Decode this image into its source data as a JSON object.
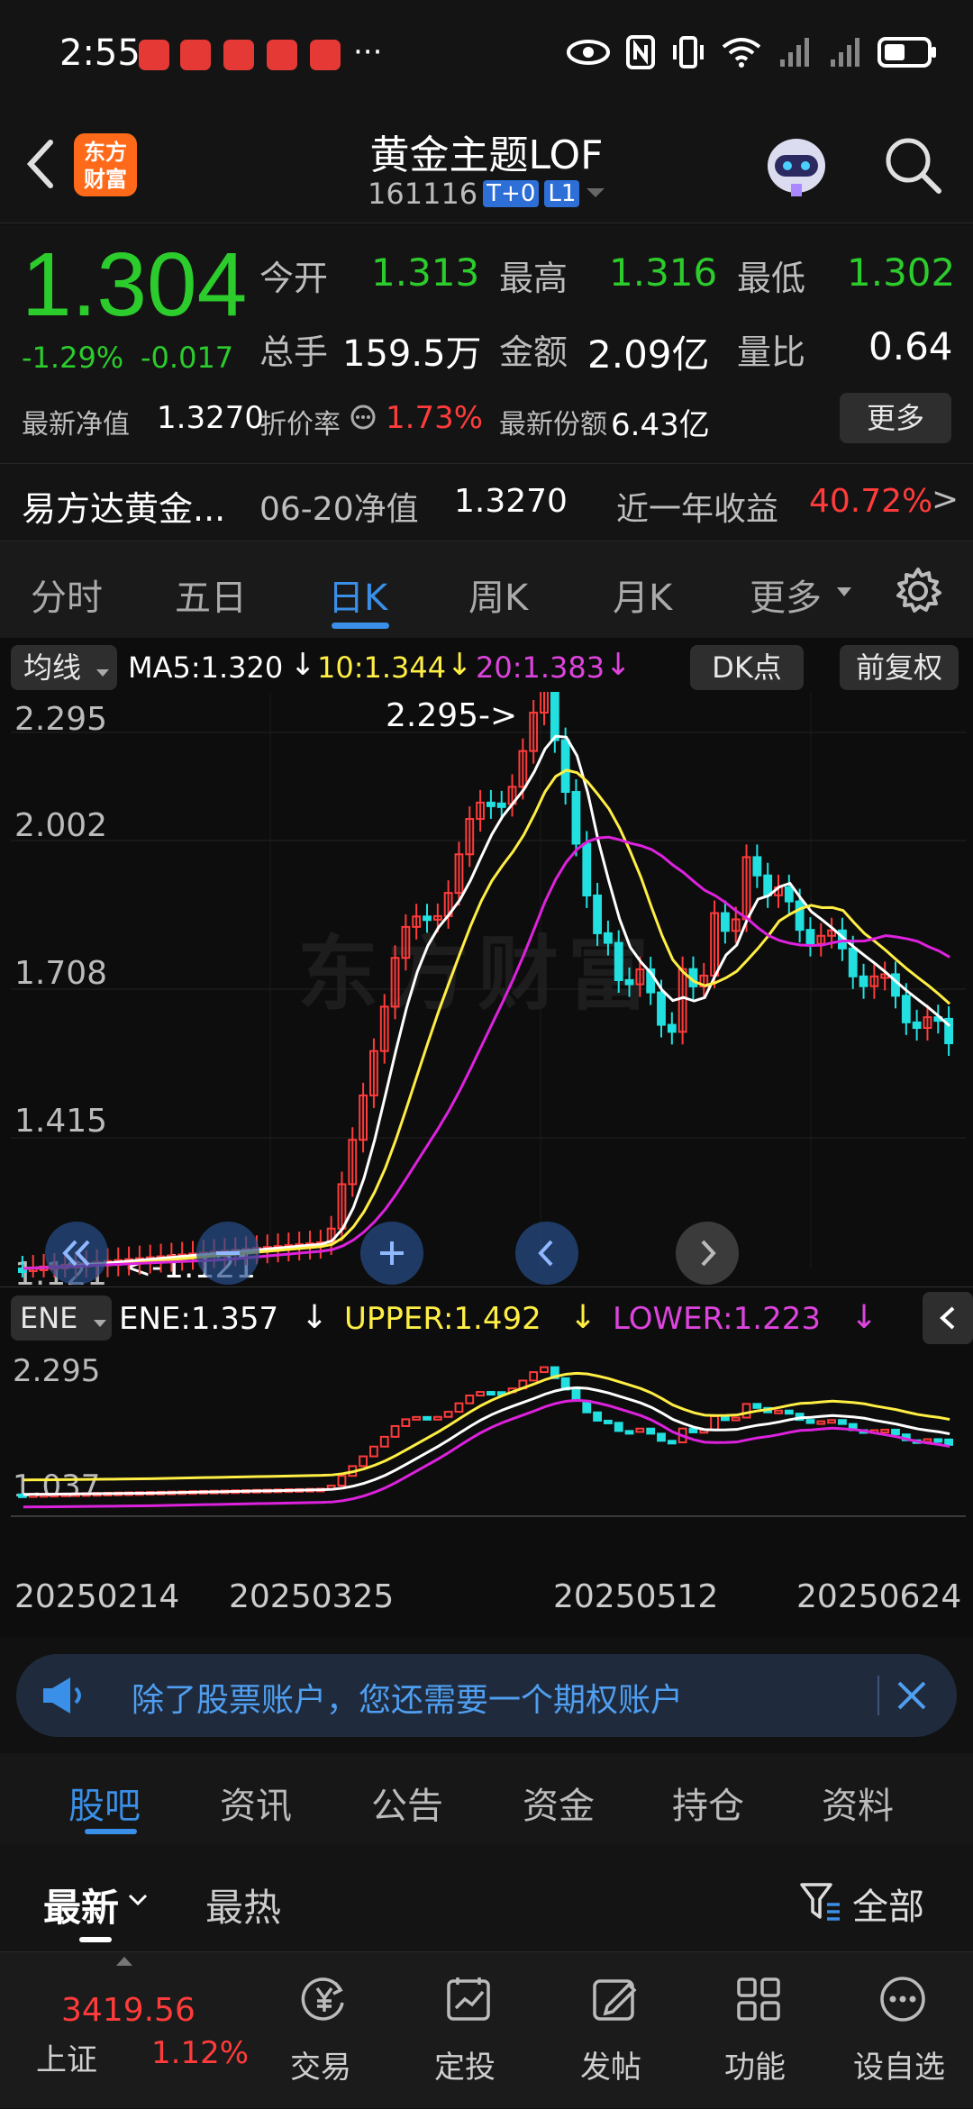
{
  "status_bar": {
    "time": "2:55",
    "more": "···"
  },
  "header": {
    "logo_text": "东方\n财富",
    "title": "黄金主题LOF",
    "code": "161116",
    "badges": [
      "T+0",
      "L1"
    ]
  },
  "quote": {
    "price": "1.304",
    "change_pct": "-1.29%",
    "change_abs": "-0.017",
    "stats": [
      {
        "label": "今开",
        "value": "1.313"
      },
      {
        "label": "最高",
        "value": "1.316"
      },
      {
        "label": "最低",
        "value": "1.302"
      },
      {
        "label": "总手",
        "value": "159.5万"
      },
      {
        "label": "金额",
        "value": "2.09亿"
      },
      {
        "label": "量比",
        "value": "0.64"
      }
    ],
    "nav_label": "最新净值",
    "nav_value": "1.3270",
    "discount_label": "折价率",
    "discount_value": "1.73%",
    "shares_label": "最新份额",
    "shares_value": "6.43亿",
    "more_button": "更多"
  },
  "fund_row": {
    "name": "易方达黄金...",
    "date_label": "06-20净值",
    "nav": "1.3270",
    "return_label": "近一年收益",
    "return_value": "40.72%",
    "arrow": ">"
  },
  "tabs": [
    "分时",
    "五日",
    "日K",
    "周K",
    "月K",
    "更多"
  ],
  "active_tab": "日K",
  "ma_bar": {
    "selector": "均线",
    "ma5": "MA5:1.320",
    "ma10": "10:1.344",
    "ma20": "20:1.383",
    "dk": "DK点",
    "adjust": "前复权"
  },
  "main_chart": {
    "y_labels": [
      "2.295",
      "2.002",
      "1.708",
      "1.415",
      "1.121"
    ],
    "max_annotation": "2.295->",
    "min_annotation": "<-1.121",
    "watermark": "东方财富"
  },
  "ene_bar": {
    "selector": "ENE",
    "ene": "ENE:1.357",
    "upper": "UPPER:1.492",
    "lower": "LOWER:1.223"
  },
  "ene_chart": {
    "y_labels": [
      "2.295",
      "1.037"
    ]
  },
  "x_dates": [
    "20250214",
    "20250325",
    "20250512",
    "20250624"
  ],
  "colors": {
    "ma5": "#ffffff",
    "ma10": "#ffee44",
    "ma20": "#dd22dd",
    "up": "#ff3b3b",
    "down": "#22e0e0",
    "accent": "#3a8fe8"
  },
  "banner": {
    "text": "除了股票账户，您还需要一个期权账户"
  },
  "bottom_tabs": [
    "股吧",
    "资讯",
    "公告",
    "资金",
    "持仓",
    "资料"
  ],
  "active_bottom_tab": "股吧",
  "sub_tabs": {
    "latest": "最新",
    "hot": "最热",
    "filter": "全部"
  },
  "bottom_nav": {
    "index_value": "3419.56",
    "index_name": "上证",
    "index_change": "1.12%",
    "items": [
      "交易",
      "定投",
      "发帖",
      "功能",
      "设自选"
    ]
  }
}
